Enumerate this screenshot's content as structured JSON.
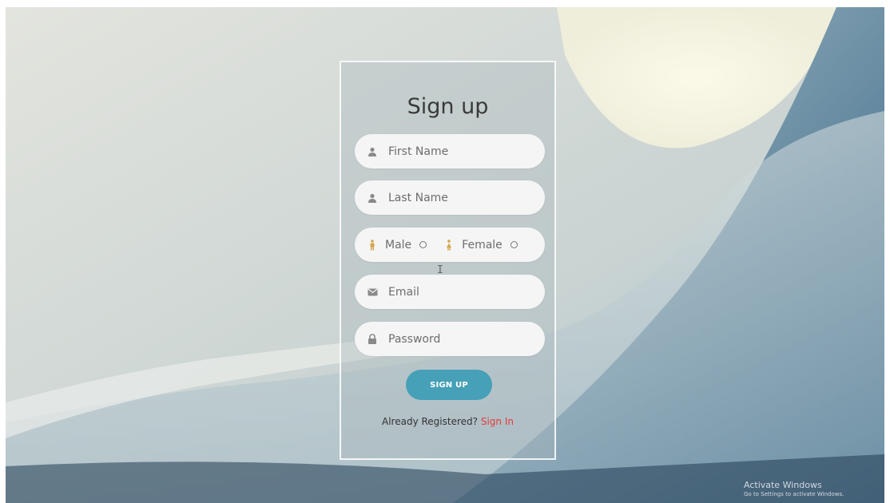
{
  "form": {
    "title": "Sign up",
    "first_name_placeholder": "First Name",
    "last_name_placeholder": "Last Name",
    "gender": {
      "male_label": "Male",
      "female_label": "Female"
    },
    "email_placeholder": "Email",
    "password_placeholder": "Password",
    "submit_label": "SIGN UP",
    "signin_prompt": "Already Registered?",
    "signin_link": "Sign In"
  },
  "watermark": {
    "title": "Activate Windows",
    "subtitle": "Go to Settings to activate Windows."
  },
  "cursor_glyph": "I",
  "colors": {
    "button": "#46a0b7",
    "link": "#e53a3a",
    "field_bg": "#f5f5f5"
  },
  "icons": {
    "first_name": "user-icon",
    "last_name": "user-icon",
    "male": "male-icon",
    "female": "female-icon",
    "email": "envelope-icon",
    "password": "lock-icon"
  }
}
